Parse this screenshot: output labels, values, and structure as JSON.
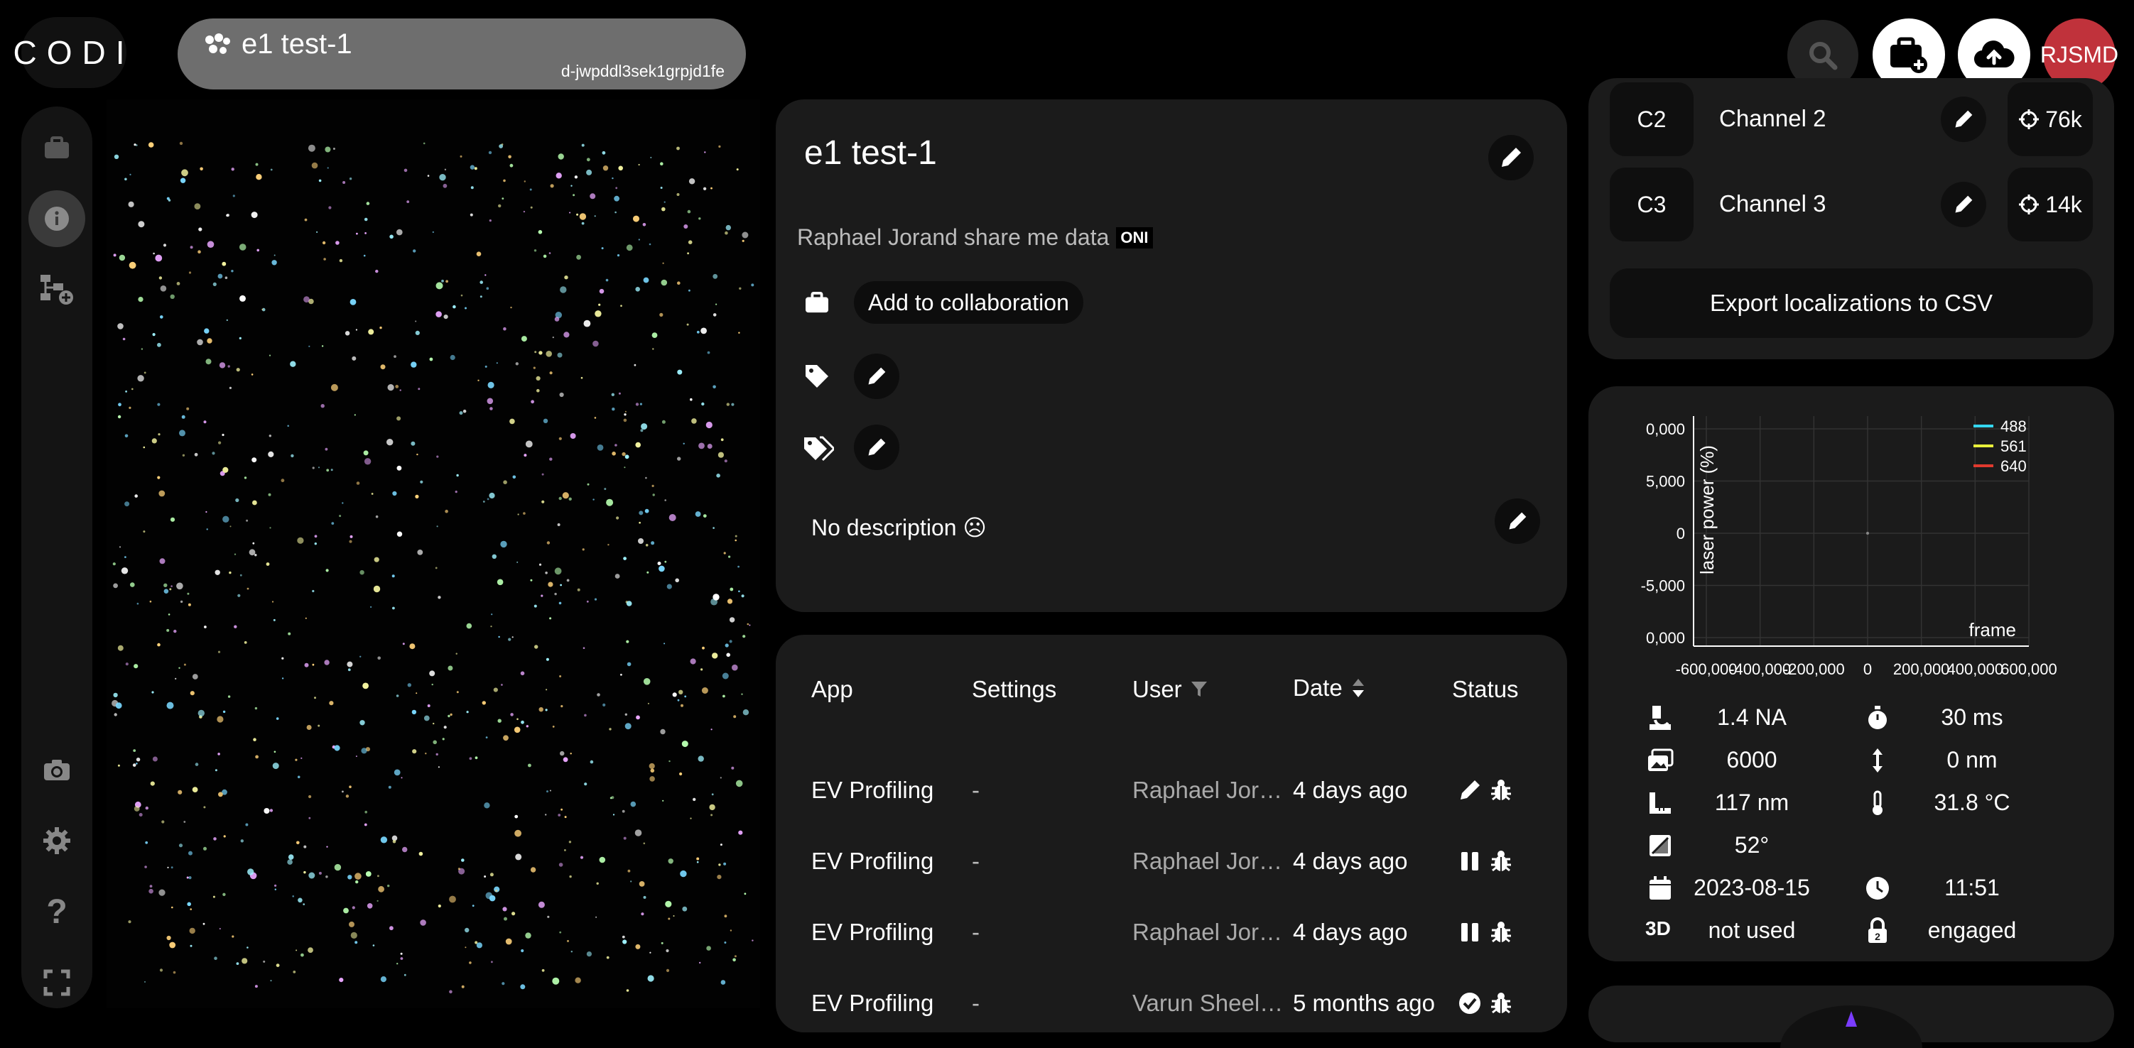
{
  "app": {
    "logo": "CODI"
  },
  "dataset": {
    "title": "e1 test-1",
    "id": "d-jwpddl3sek1grpjd1fe"
  },
  "user": {
    "initials": "RJSMD"
  },
  "info": {
    "title": "e1 test-1",
    "owner_line": "Raphael Jorand share me data",
    "format_badge": "ONI",
    "add_collab_label": "Add to collaboration",
    "description": "No description ☹"
  },
  "apps_table": {
    "columns": [
      "App",
      "Settings",
      "User",
      "Date",
      "Status"
    ],
    "rows": [
      {
        "app": "EV Profiling",
        "settings": "-",
        "user": "Raphael Jor…",
        "date": "4 days ago",
        "status": "edit"
      },
      {
        "app": "EV Profiling",
        "settings": "-",
        "user": "Raphael Jor…",
        "date": "4 days ago",
        "status": "paused"
      },
      {
        "app": "EV Profiling",
        "settings": "-",
        "user": "Raphael Jor…",
        "date": "4 days ago",
        "status": "paused"
      },
      {
        "app": "EV Profiling",
        "settings": "-",
        "user": "Varun Sheel…",
        "date": "5 months ago",
        "status": "done"
      }
    ]
  },
  "channels": [
    {
      "code": "C2",
      "name": "Channel 2",
      "count": "76k"
    },
    {
      "code": "C3",
      "name": "Channel 3",
      "count": "14k"
    }
  ],
  "export_label": "Export localizations to CSV",
  "chart_data": {
    "type": "line",
    "xlabel": "frame",
    "ylabel": "laser power (%)",
    "x_ticks": [
      "-600,000",
      "-400,000",
      "-200,000",
      "0",
      "200,000",
      "400,000",
      "600,000"
    ],
    "y_ticks": [
      "0,000",
      "5,000",
      "0",
      "-5,000",
      "0,000"
    ],
    "series": [
      {
        "name": "488",
        "color": "#35d6f0",
        "values": []
      },
      {
        "name": "561",
        "color": "#e8f03a",
        "values": []
      },
      {
        "name": "640",
        "color": "#e03a2e",
        "values": []
      }
    ]
  },
  "metadata": {
    "na": "1.4 NA",
    "exposure": "30 ms",
    "frames": "6000",
    "z_step": "0 nm",
    "pixel_size": "117 nm",
    "temperature": "31.8 °C",
    "angle": "52°",
    "date": "2023-08-15",
    "time": "11:51",
    "mode_3d_label": "3D",
    "mode_3d": "not used",
    "lock": "engaged"
  },
  "colors": {
    "accent_red": "#c0323b",
    "panel": "#1b1b1b"
  }
}
